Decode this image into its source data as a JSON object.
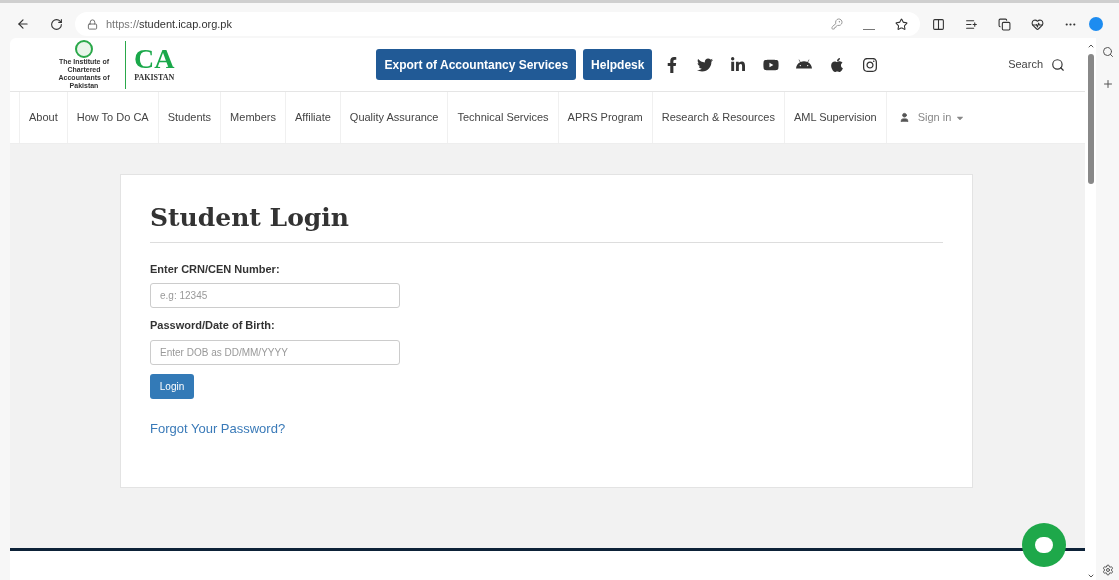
{
  "browser": {
    "url_scheme": "https://",
    "url_host": "student.icap.org.pk"
  },
  "logo": {
    "institute": "The Institute of Chartered Accountants of Pakistan",
    "mark": "CA",
    "country": "PAKISTAN"
  },
  "header_buttons": [
    "Export of Accountancy Services",
    "Helpdesk"
  ],
  "social": [
    {
      "kind": "facebook"
    },
    {
      "kind": "twitter"
    },
    {
      "kind": "linkedin"
    },
    {
      "kind": "youtube"
    },
    {
      "kind": "android"
    },
    {
      "kind": "apple"
    },
    {
      "kind": "instagram"
    }
  ],
  "search": {
    "label": "Search"
  },
  "nav": [
    "About",
    "How To Do CA",
    "Students",
    "Members",
    "Affiliate",
    "Quality Assurance",
    "Technical Services",
    "APRS Program",
    "Research & Resources",
    "AML Supervision"
  ],
  "sign_in": "Sign in",
  "login": {
    "title": "Student Login",
    "fields": [
      {
        "label": "Enter CRN/CEN Number:",
        "placeholder": "e.g: 12345"
      },
      {
        "label": "Password/Date of Birth:",
        "placeholder": "Enter DOB as DD/MM/YYYY"
      }
    ],
    "button": "Login",
    "forgot": "Forgot Your Password?"
  }
}
